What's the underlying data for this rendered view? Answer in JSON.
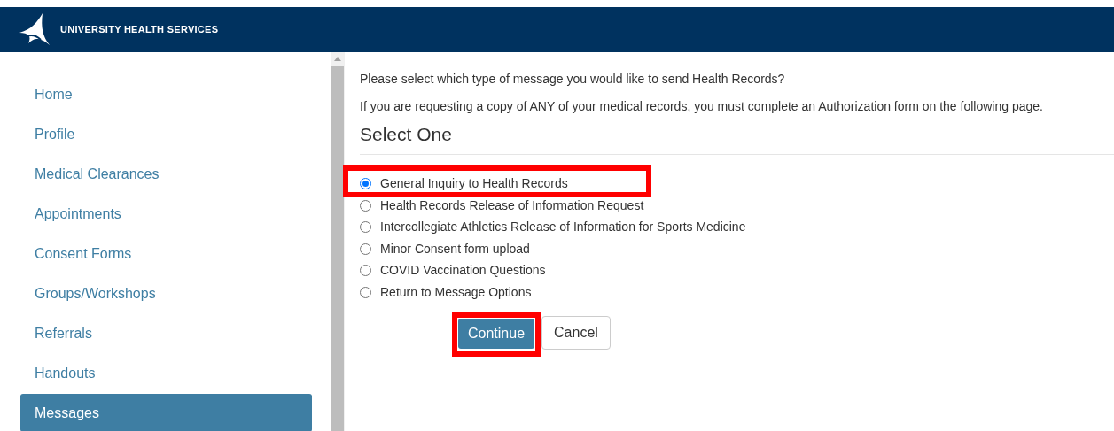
{
  "header": {
    "title": "UNIVERSITY HEALTH SERVICES"
  },
  "sidebar": {
    "items": [
      {
        "label": "Home",
        "selected": false
      },
      {
        "label": "Profile",
        "selected": false
      },
      {
        "label": "Medical Clearances",
        "selected": false
      },
      {
        "label": "Appointments",
        "selected": false
      },
      {
        "label": "Consent Forms",
        "selected": false
      },
      {
        "label": "Groups/Workshops",
        "selected": false
      },
      {
        "label": "Referrals",
        "selected": false
      },
      {
        "label": "Handouts",
        "selected": false
      },
      {
        "label": "Messages",
        "selected": true
      }
    ]
  },
  "content": {
    "question": "Please select which type of message you would like to send Health Records?",
    "note": "If you are requesting a copy of ANY of your medical records, you must complete an Authorization form on the following page.",
    "heading": "Select One",
    "options": [
      {
        "label": "General Inquiry to Health Records",
        "selected": true,
        "highlighted": true
      },
      {
        "label": "Health Records Release of Information Request",
        "selected": false,
        "highlighted": false
      },
      {
        "label": "Intercollegiate Athletics Release of Information for Sports Medicine",
        "selected": false,
        "highlighted": false
      },
      {
        "label": "Minor Consent form upload",
        "selected": false,
        "highlighted": false
      },
      {
        "label": "COVID Vaccination Questions",
        "selected": false,
        "highlighted": false
      },
      {
        "label": "Return to Message Options",
        "selected": false,
        "highlighted": false
      }
    ],
    "buttons": [
      {
        "label": "Continue",
        "kind": "primary",
        "highlighted": true
      },
      {
        "label": "Cancel",
        "kind": "secondary",
        "highlighted": false
      }
    ]
  }
}
